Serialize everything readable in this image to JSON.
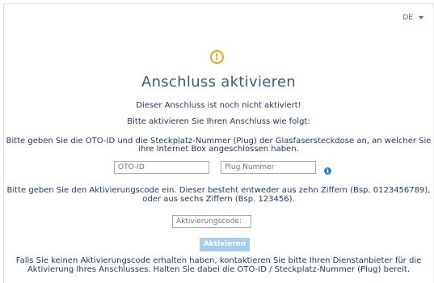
{
  "language": {
    "current": "DE"
  },
  "icons": {
    "warning": "warning-circle-icon",
    "info": "info-icon",
    "caret": "chevron-down-icon"
  },
  "colors": {
    "accent": "#f2a516",
    "primary_text": "#1f3a67",
    "button_disabled": "#a9cdf0",
    "info": "#2d7fd3"
  },
  "page": {
    "title": "Anschluss aktivieren",
    "status_line": "Dieser Anschluss ist noch nicht aktiviert!",
    "instruction_line": "Bitte aktivieren Sie Ihren Anschluss wie folgt:",
    "step1_line1": "Bitte geben Sie die OTO-ID und die Steckplatz-Nummer (Plug) der Glasfasersteckdose an, an welcher Sie",
    "step1_line2": "ihre Internet Box angeschlossen haben.",
    "step2_line1": "Bitte geben Sie den Aktivierungscode ein. Dieser besteht entweder aus zehn Ziffern (Bsp. 0123456789),",
    "step2_line2": "oder aus sechs Ziffern (Bsp. 123456).",
    "footer_line1": "Falls Sie keinen Aktivierungscode erhalten haben, kontaktieren Sie bitte Ihren Dienstanbieter für die",
    "footer_line2": "Aktivierung Ihres Anschlusses. Halten Sie dabei die OTO-ID / Steckplatz-Nummer (Plug) bereit."
  },
  "form": {
    "oto_id_placeholder": "OTO-ID",
    "oto_id_value": "",
    "plug_placeholder": "Plug Nummer",
    "plug_value": "",
    "code_placeholder": "Aktivierungscode:",
    "code_value": "",
    "submit_label": "Aktivieren"
  }
}
